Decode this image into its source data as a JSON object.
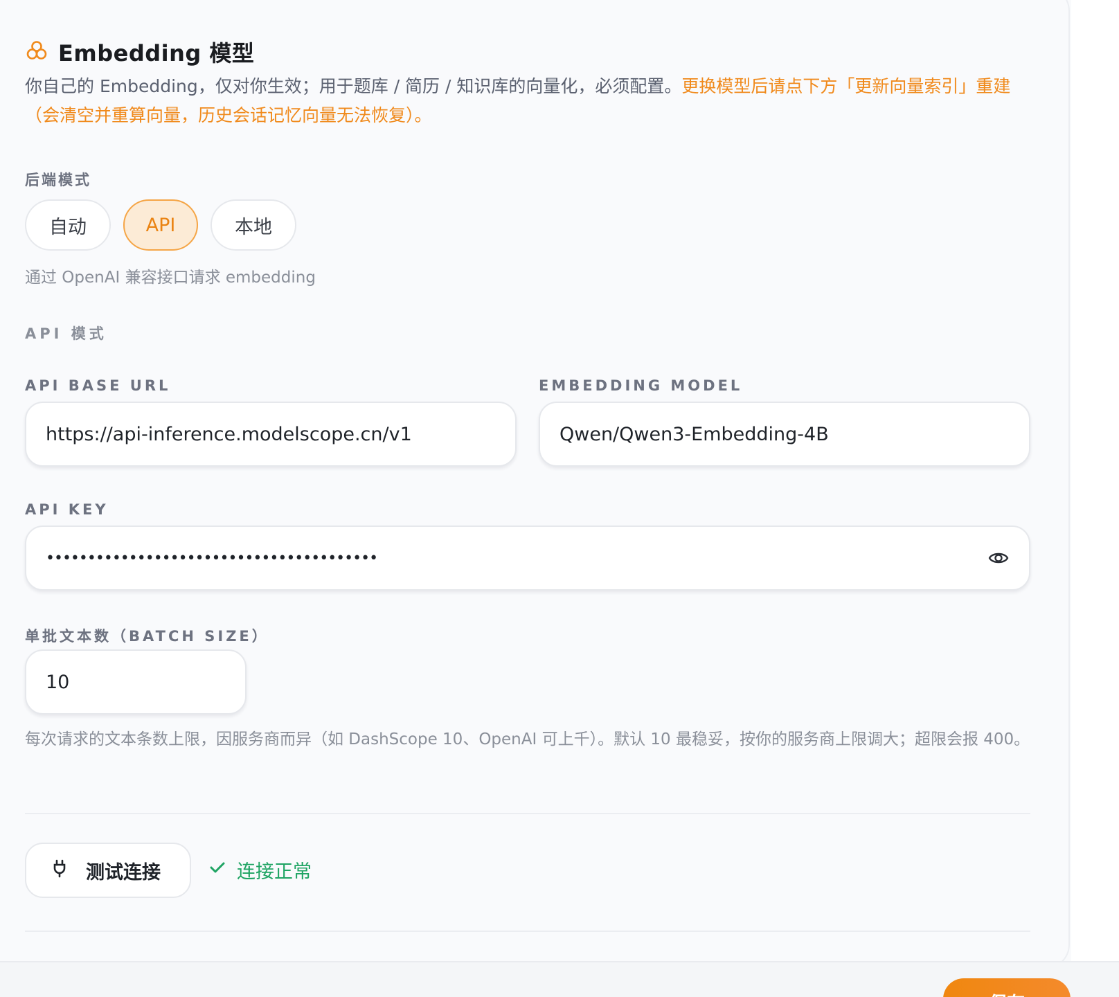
{
  "section": {
    "icon": "model-cluster-icon",
    "title": "Embedding 模型",
    "desc_plain": "你自己的 Embedding，仅对你生效；用于题库 / 简历 / 知识库的向量化，必须配置。",
    "desc_warn": "更换模型后请点下方「更新向量索引」重建（会清空并重算向量，历史会话记忆向量无法恢复）。"
  },
  "backend": {
    "label": "后端模式",
    "options": [
      "自动",
      "API",
      "本地"
    ],
    "selected": "API",
    "hint": "通过 OpenAI 兼容接口请求 embedding"
  },
  "api_mode": {
    "label": "API 模式",
    "base_url": {
      "label": "API BASE URL",
      "value": "https://api-inference.modelscope.cn/v1"
    },
    "model": {
      "label": "EMBEDDING MODEL",
      "value": "Qwen/Qwen3-Embedding-4B"
    },
    "key": {
      "label": "API KEY",
      "value": "••••••••••••••••••••••••••••••••••••••••"
    }
  },
  "batch": {
    "label": "单批文本数（BATCH SIZE）",
    "value": "10",
    "hint": "每次请求的文本条数上限，因服务商而异（如 DashScope 10、OpenAI 可上千）。默认 10 最稳妥，按你的服务商上限调大；超限会报 400。"
  },
  "test": {
    "button_label": "测试连接",
    "status": "连接正常",
    "status_color": "#1fa463"
  },
  "footer": {
    "save_label": "保存"
  },
  "colors": {
    "accent": "#f08a1c",
    "active_bg": "#fcebd6",
    "success": "#1fa463"
  }
}
